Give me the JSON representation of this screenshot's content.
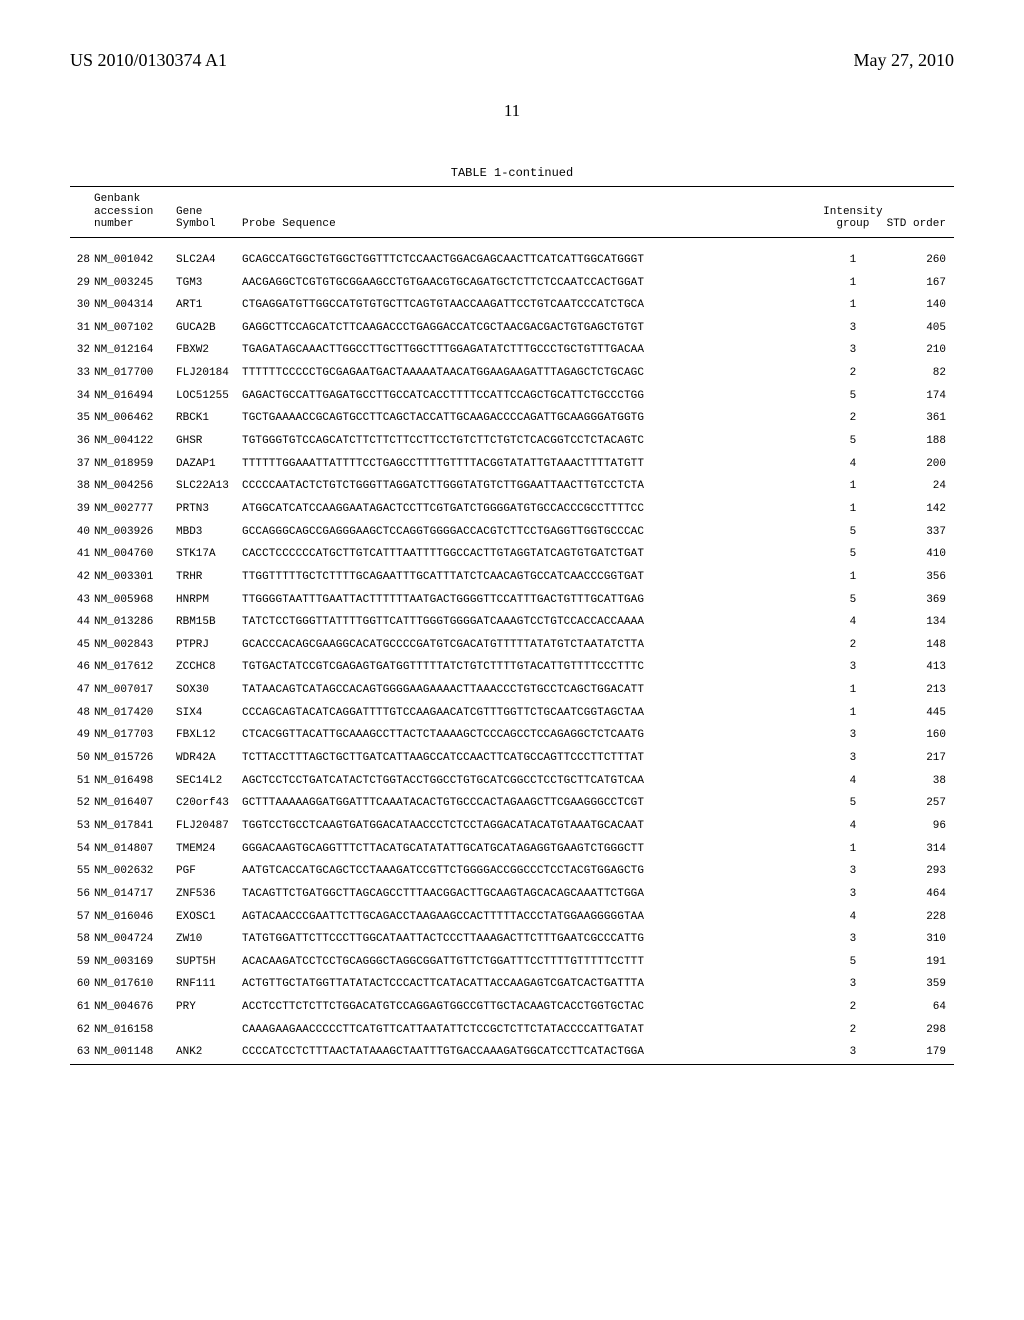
{
  "header": {
    "pub_number": "US 2010/0130374 A1",
    "pub_date": "May 27, 2010",
    "page_number": "11"
  },
  "table": {
    "title": "TABLE 1-continued",
    "columns": {
      "c1a": "Genbank",
      "c1b": "accession",
      "c1c": "number",
      "c2a": "Gene",
      "c2b": "Symbol",
      "c3": "Probe Sequence",
      "c4a": "Intensity",
      "c4b": "group",
      "c5": "STD order"
    },
    "rows": [
      {
        "n": "28",
        "acc": "NM_001042",
        "sym": "SLC2A4",
        "seq": "GCAGCCATGGCTGTGGCTGGTTTCTCCAACTGGACGAGCAACTTCATCATTGGCATGGGT",
        "grp": "1",
        "ord": "260"
      },
      {
        "n": "29",
        "acc": "NM_003245",
        "sym": "TGM3",
        "seq": "AACGAGGCTCGTGTGCGGAAGCCTGTGAACGTGCAGATGCTCTTCTCCAATCCACTGGAT",
        "grp": "1",
        "ord": "167"
      },
      {
        "n": "30",
        "acc": "NM_004314",
        "sym": "ART1",
        "seq": "CTGAGGATGTTGGCCATGTGTGCTTCAGTGTAACCAAGATTCCTGTCAATCCCATCTGCA",
        "grp": "1",
        "ord": "140"
      },
      {
        "n": "31",
        "acc": "NM_007102",
        "sym": "GUCA2B",
        "seq": "GAGGCTTCCAGCATCTTCAAGACCCTGAGGACCATCGCTAACGACGACTGTGAGCTGTGT",
        "grp": "3",
        "ord": "405"
      },
      {
        "n": "32",
        "acc": "NM_012164",
        "sym": "FBXW2",
        "seq": "TGAGATAGCAAACTTGGCCTTGCTTGGCTTTGGAGATATCTTTGCCCTGCTGTTTGACAA",
        "grp": "3",
        "ord": "210"
      },
      {
        "n": "33",
        "acc": "NM_017700",
        "sym": "FLJ20184",
        "seq": "TTTTTTCCCCCTGCGAGAATGACTAAAAATAACATGGAAGAAGATTTAGAGCTCTGCAGC",
        "grp": "2",
        "ord": "82"
      },
      {
        "n": "34",
        "acc": "NM_016494",
        "sym": "LOC51255",
        "seq": "GAGACTGCCATTGAGATGCCTTGCCATCACCTTTTCCATTCCAGCTGCATTCTGCCCTGG",
        "grp": "5",
        "ord": "174"
      },
      {
        "n": "35",
        "acc": "NM_006462",
        "sym": "RBCK1",
        "seq": "TGCTGAAAACCGCAGTGCCTTCAGCTACCATTGCAAGACCCCAGATTGCAAGGGATGGTG",
        "grp": "2",
        "ord": "361"
      },
      {
        "n": "36",
        "acc": "NM_004122",
        "sym": "GHSR",
        "seq": "TGTGGGTGTCCAGCATCTTCTTCTTCCTTCCTGTCTTCTGTCTCACGGTCCTCTACAGTC",
        "grp": "5",
        "ord": "188"
      },
      {
        "n": "37",
        "acc": "NM_018959",
        "sym": "DAZAP1",
        "seq": "TTTTTTGGAAATTATTTTCCTGAGCCTTTTGTTTTACGGTATATTGTAAACTTTTATGTT",
        "grp": "4",
        "ord": "200"
      },
      {
        "n": "38",
        "acc": "NM_004256",
        "sym": "SLC22A13",
        "seq": "CCCCCAATACTCTGTCTGGGTTAGGATCTTGGGTATGTCTTGGAATTAACTTGTCCTCTA",
        "grp": "1",
        "ord": "24"
      },
      {
        "n": "39",
        "acc": "NM_002777",
        "sym": "PRTN3",
        "seq": "ATGGCATCATCCAAGGAATAGACTCCTTCGTGATCTGGGGATGTGCCACCCGCCTTTTCC",
        "grp": "1",
        "ord": "142"
      },
      {
        "n": "40",
        "acc": "NM_003926",
        "sym": "MBD3",
        "seq": "GCCAGGGCAGCCGAGGGAAGCTCCAGGTGGGGACCACGTCTTCCTGAGGTTGGTGCCCAC",
        "grp": "5",
        "ord": "337"
      },
      {
        "n": "41",
        "acc": "NM_004760",
        "sym": "STK17A",
        "seq": "CACCTCCCCCCATGCTTGTCATTTAATTTTGGCCACTTGTAGGTATCAGTGTGATCTGAT",
        "grp": "5",
        "ord": "410"
      },
      {
        "n": "42",
        "acc": "NM_003301",
        "sym": "TRHR",
        "seq": "TTGGTTTTTGCTCTTTTGCAGAATTTGCATTTATCTCAACAGTGCCATCAACCCGGTGAT",
        "grp": "1",
        "ord": "356"
      },
      {
        "n": "43",
        "acc": "NM_005968",
        "sym": "HNRPM",
        "seq": "TTGGGGTAATTTGAATTACTTTTTTAATGACTGGGGTTCCATTTGACTGTTTGCATTGAG",
        "grp": "5",
        "ord": "369"
      },
      {
        "n": "44",
        "acc": "NM_013286",
        "sym": "RBM15B",
        "seq": "TATCTCCTGGGTTATTTTGGTTCATTTGGGTGGGGATCAAAGTCCTGTCCACCACCAAAA",
        "grp": "4",
        "ord": "134"
      },
      {
        "n": "45",
        "acc": "NM_002843",
        "sym": "PTPRJ",
        "seq": "GCACCCACAGCGAAGGCACATGCCCCGATGTCGACATGTTTTTATATGTCTAATATCTTA",
        "grp": "2",
        "ord": "148"
      },
      {
        "n": "46",
        "acc": "NM_017612",
        "sym": "ZCCHC8",
        "seq": "TGTGACTATCCGTCGAGAGTGATGGTTTTTATCTGTCTTTTGTACATTGTTTTCCCTTTC",
        "grp": "3",
        "ord": "413"
      },
      {
        "n": "47",
        "acc": "NM_007017",
        "sym": "SOX30",
        "seq": "TATAACAGTCATAGCCACAGTGGGGAAGAAAACTTAAACCCTGTGCCTCAGCTGGACATT",
        "grp": "1",
        "ord": "213"
      },
      {
        "n": "48",
        "acc": "NM_017420",
        "sym": "SIX4",
        "seq": "CCCAGCAGTACATCAGGATTTTGTCCAAGAACATCGTTTGGTTCTGCAATCGGTAGCTAA",
        "grp": "1",
        "ord": "445"
      },
      {
        "n": "49",
        "acc": "NM_017703",
        "sym": "FBXL12",
        "seq": "CTCACGGTTACATTGCAAAGCCTTACTCTAAAAGCTCCCAGCCTCCAGAGGCTCTCAATG",
        "grp": "3",
        "ord": "160"
      },
      {
        "n": "50",
        "acc": "NM_015726",
        "sym": "WDR42A",
        "seq": "TCTTACCTTTAGCTGCTTGATCATTAAGCCATCCAACTTCATGCCAGTTCCCTTCTTTAT",
        "grp": "3",
        "ord": "217"
      },
      {
        "n": "51",
        "acc": "NM_016498",
        "sym": "SEC14L2",
        "seq": "AGCTCCTCCTGATCATACTCTGGTACCTGGCCTGTGCATCGGCCTCCTGCTTCATGTCAA",
        "grp": "4",
        "ord": "38"
      },
      {
        "n": "52",
        "acc": "NM_016407",
        "sym": "C20orf43",
        "seq": "GCTTTAAAAAGGATGGATTTCAAATACACTGTGCCCACTAGAAGCTTCGAAGGGCCTCGT",
        "grp": "5",
        "ord": "257"
      },
      {
        "n": "53",
        "acc": "NM_017841",
        "sym": "FLJ20487",
        "seq": "TGGTCCTGCCTCAAGTGATGGACATAACCCTCTCCTAGGACATACATGTAAATGCACAAT",
        "grp": "4",
        "ord": "96"
      },
      {
        "n": "54",
        "acc": "NM_014807",
        "sym": "TMEM24",
        "seq": "GGGACAAGTGCAGGTTTCTTACATGCATATATTGCATGCATAGAGGTGAAGTCTGGGCTT",
        "grp": "1",
        "ord": "314"
      },
      {
        "n": "55",
        "acc": "NM_002632",
        "sym": "PGF",
        "seq": "AATGTCACCATGCAGCTCCTAAAGATCCGTTCTGGGGACCGGCCCTCCTACGTGGAGCTG",
        "grp": "3",
        "ord": "293"
      },
      {
        "n": "56",
        "acc": "NM_014717",
        "sym": "ZNF536",
        "seq": "TACAGTTCTGATGGCTTAGCAGCCTTTAACGGACTTGCAAGTAGCACAGCAAATTCTGGA",
        "grp": "3",
        "ord": "464"
      },
      {
        "n": "57",
        "acc": "NM_016046",
        "sym": "EXOSC1",
        "seq": "AGTACAACCCGAATTCTTGCAGACCTAAGAAGCCACTTTTTACCCTATGGAAGGGGGTAA",
        "grp": "4",
        "ord": "228"
      },
      {
        "n": "58",
        "acc": "NM_004724",
        "sym": "ZW10",
        "seq": "TATGTGGATTCTTCCCTTGGCATAATTACTCCCTTAAAGACTTCTTTGAATCGCCCATTG",
        "grp": "3",
        "ord": "310"
      },
      {
        "n": "59",
        "acc": "NM_003169",
        "sym": "SUPT5H",
        "seq": "ACACAAGATCCTCCTGCAGGGCTAGGCGGATTGTTCTGGATTTCCTTTTGTTTTTCCTTT",
        "grp": "5",
        "ord": "191"
      },
      {
        "n": "60",
        "acc": "NM_017610",
        "sym": "RNF111",
        "seq": "ACTGTTGCTATGGTTATATACTCCCACTTCATACATTACCAAGAGTCGATCACTGATTTA",
        "grp": "3",
        "ord": "359"
      },
      {
        "n": "61",
        "acc": "NM_004676",
        "sym": "PRY",
        "seq": "ACCTCCTTCTCTTCTGGACATGTCCAGGAGTGGCCGTTGCTACAAGTCACCTGGTGCTAC",
        "grp": "2",
        "ord": "64"
      },
      {
        "n": "62",
        "acc": "NM_016158",
        "sym": "",
        "seq": "CAAAGAAGAACCCCCTTCATGTTCATTAATATTCTCCGCTCTTCTATACCCCATTGATAT",
        "grp": "2",
        "ord": "298"
      },
      {
        "n": "63",
        "acc": "NM_001148",
        "sym": "ANK2",
        "seq": "CCCCATCCTCTTTAACTATAAAGCTAATTTGTGACCAAAGATGGCATCCTTCATACTGGA",
        "grp": "3",
        "ord": "179"
      }
    ]
  }
}
